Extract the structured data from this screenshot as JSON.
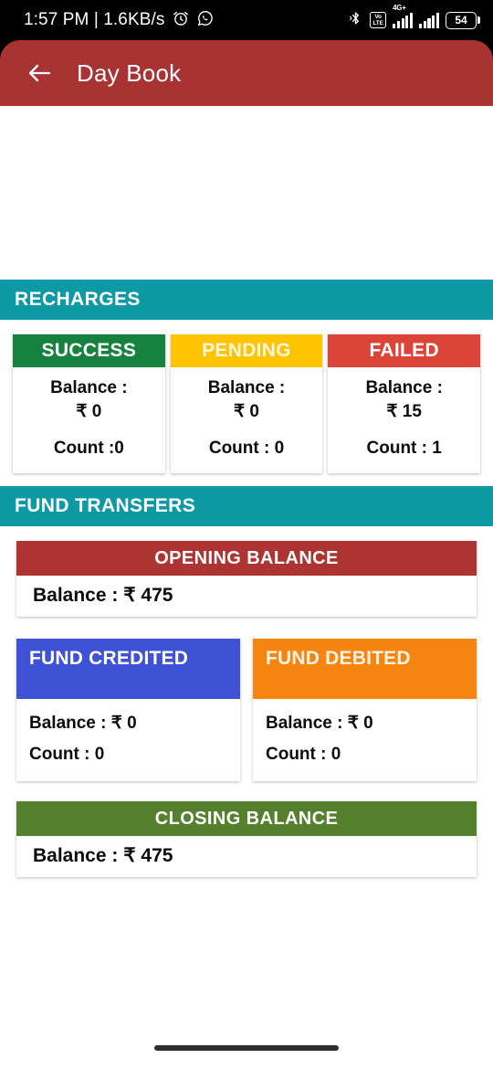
{
  "status_bar": {
    "clock": "1:57 PM | 1.6KB/s",
    "alarm_icon": "alarm-clock-icon",
    "whatsapp_icon": "whatsapp-icon",
    "bluetooth_icon": "bluetooth-icon",
    "volte_top": "Vo",
    "volte_bottom": "LTE",
    "network_type": "4G+",
    "battery_percent": "54"
  },
  "appbar": {
    "back_icon": "back-arrow-icon",
    "title": "Day Book",
    "color": "#a93232"
  },
  "colors": {
    "section_teal": "#0d9aa4",
    "success_green": "#17813f",
    "pending_yellow": "#ffc400",
    "failed_red": "#dc4437",
    "opening_red": "#ae3434",
    "closing_green": "#55812f",
    "credited_blue": "#3f51d5",
    "debited_orange": "#f58410"
  },
  "recharges": {
    "section_title": "RECHARGES",
    "cards": [
      {
        "title": "SUCCESS",
        "balance_label": "Balance :",
        "balance_value": "₹ 0",
        "count": "Count :0"
      },
      {
        "title": "PENDING",
        "balance_label": "Balance :",
        "balance_value": "₹ 0",
        "count": "Count : 0"
      },
      {
        "title": "FAILED",
        "balance_label": "Balance :",
        "balance_value": "₹ 15",
        "count": "Count : 1"
      }
    ]
  },
  "fund_transfers": {
    "section_title": "FUND TRANSFERS",
    "opening": {
      "title": "OPENING BALANCE",
      "balance": "Balance : ₹ 475"
    },
    "credited": {
      "title": "FUND CREDITED",
      "balance": "Balance : ₹ 0",
      "count": "Count : 0"
    },
    "debited": {
      "title": "FUND DEBITED",
      "balance": "Balance : ₹ 0",
      "count": "Count : 0"
    },
    "closing": {
      "title": "CLOSING BALANCE",
      "balance": "Balance : ₹ 475"
    }
  },
  "navigation": {
    "home_pill": "home-gesture-pill"
  }
}
